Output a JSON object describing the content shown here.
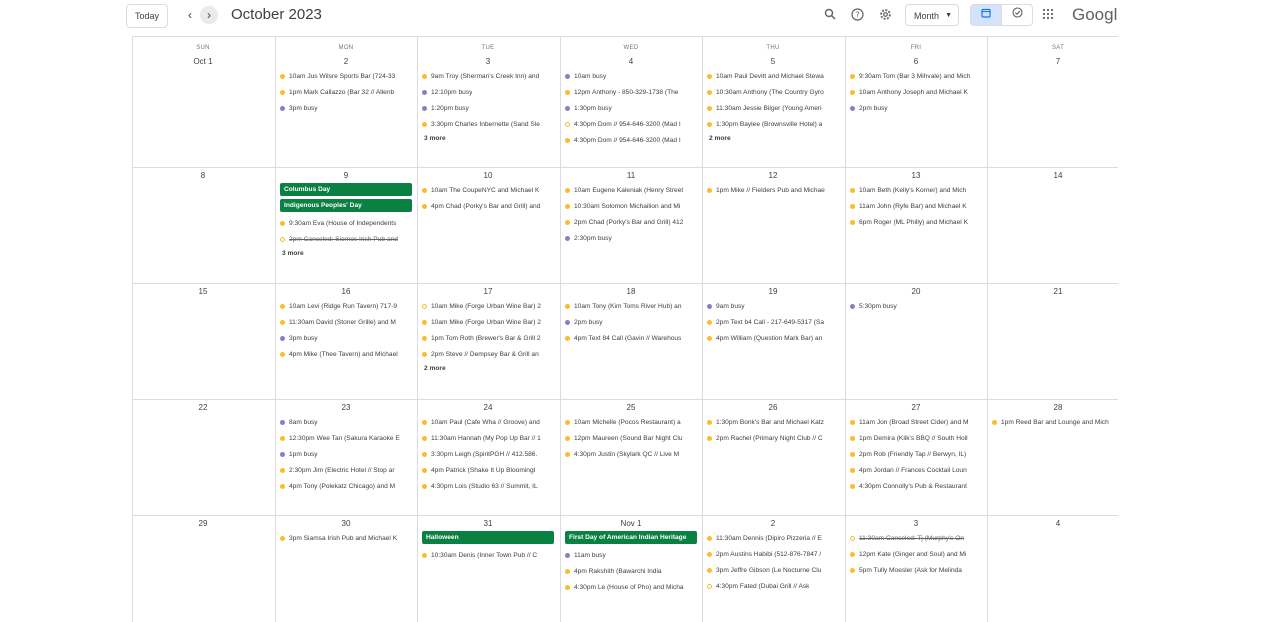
{
  "header": {
    "today_label": "Today",
    "prev_icon": "chevron-left-icon",
    "next_icon": "chevron-right-icon",
    "month_title": "October 2023",
    "search_icon": "search-icon",
    "help_icon": "help-icon",
    "settings_icon": "gear-icon",
    "view_select": "Month",
    "calendar_view_icon": "calendar-icon",
    "tasks_view_icon": "check-circle-icon",
    "apps_icon": "apps-grid-icon",
    "logo_text": "Google"
  },
  "colors": {
    "accent_yellow": "#f6bf26",
    "accent_purple": "#8e7cc3",
    "accent_blue": "#7986cb",
    "holiday_green": "#0b8043",
    "selected_toggle": "#d3e3fd"
  },
  "weekdays": [
    "SUN",
    "MON",
    "TUE",
    "WED",
    "THU",
    "FRI",
    "SAT"
  ],
  "weeks": [
    [
      {
        "day": "Oct 1",
        "events": []
      },
      {
        "day": "2",
        "events": [
          {
            "text": "10am Jus Wilsre Sports Bar (724-33",
            "color": "yellow"
          },
          {
            "text": "1pm Mark Callazzo (Bar 32 // Allenb",
            "color": "yellow"
          },
          {
            "text": "3pm busy",
            "color": "purple"
          }
        ]
      },
      {
        "day": "3",
        "events": [
          {
            "text": "9am Troy (Sherman's Creek Inn) and",
            "color": "yellow"
          },
          {
            "text": "12:10pm busy",
            "color": "purple"
          },
          {
            "text": "1:20pm busy",
            "color": "purple"
          },
          {
            "text": "3:30pm Charles Inbernette (Sand Sle",
            "color": "yellow"
          }
        ],
        "more": "3 more"
      },
      {
        "day": "4",
        "events": [
          {
            "text": "10am busy",
            "color": "purple"
          },
          {
            "text": "12pm Anthony - 850-329-1738 (The",
            "color": "yellow"
          },
          {
            "text": "1:30pm busy",
            "color": "purple"
          },
          {
            "text": "4:30pm Dom // 954-646-3200 (Mad I",
            "color": "hollow"
          },
          {
            "text": "4:30pm Dom // 954-646-3200 (Mad I",
            "color": "yellow"
          }
        ]
      },
      {
        "day": "5",
        "events": [
          {
            "text": "10am Paul Devitt and Michael Stewa",
            "color": "yellow"
          },
          {
            "text": "10:30am Anthony (The Country Gyro",
            "color": "yellow"
          },
          {
            "text": "11:30am Jessie Bilger (Young Ameri",
            "color": "yellow"
          },
          {
            "text": "1:30pm Baylee (Brownsville Hotel) a",
            "color": "yellow"
          }
        ],
        "more": "2 more"
      },
      {
        "day": "6",
        "events": [
          {
            "text": "9:30am Tom (Bar 3 Mihvale) and Mich",
            "color": "yellow"
          },
          {
            "text": "10am Anthony Joseph and Michael K",
            "color": "yellow"
          },
          {
            "text": "2pm busy",
            "color": "purple"
          }
        ]
      },
      {
        "day": "7",
        "events": []
      }
    ],
    [
      {
        "day": "8",
        "events": []
      },
      {
        "day": "9",
        "allday": [
          "Columbus Day",
          "Indigenous Peoples' Day"
        ],
        "events": [
          {
            "text": "9:30am Eva (House of Independents",
            "color": "yellow"
          },
          {
            "text": "2pm Canceled: Siomos Irish Pub and",
            "color": "hollow",
            "strike": true
          }
        ],
        "more": "3 more"
      },
      {
        "day": "10",
        "events": [
          {
            "text": "10am The CoupeNYC and Michael K",
            "color": "yellow"
          },
          {
            "text": "4pm Chad (Porky's Bar and Grill) and",
            "color": "yellow"
          }
        ]
      },
      {
        "day": "11",
        "events": [
          {
            "text": "10am Eugene Kaleniak (Henry Street",
            "color": "yellow"
          },
          {
            "text": "10:30am Solomon Michailion and Mi",
            "color": "yellow"
          },
          {
            "text": "2pm Chad (Porky's Bar and Grill) 412",
            "color": "yellow"
          },
          {
            "text": "2:30pm busy",
            "color": "purple"
          }
        ]
      },
      {
        "day": "12",
        "events": [
          {
            "text": "1pm Mike // Fielders Pub and Michae",
            "color": "yellow"
          }
        ]
      },
      {
        "day": "13",
        "events": [
          {
            "text": "10am Beth (Kelly's Korner) and Mich",
            "color": "yellow"
          },
          {
            "text": "11am John (Ryfe Bar) and Michael K",
            "color": "yellow"
          },
          {
            "text": "6pm Roger (ML Philly) and Michael K",
            "color": "yellow"
          }
        ]
      },
      {
        "day": "14",
        "events": []
      }
    ],
    [
      {
        "day": "15",
        "events": []
      },
      {
        "day": "16",
        "events": [
          {
            "text": "10am Levi (Ridge Run Tavern) 717-9",
            "color": "yellow"
          },
          {
            "text": "11:30am David (Stoner Grille) and M",
            "color": "yellow"
          },
          {
            "text": "3pm busy",
            "color": "purple"
          },
          {
            "text": "4pm Mike (Thee Tavern) and Michael",
            "color": "yellow"
          }
        ]
      },
      {
        "day": "17",
        "events": [
          {
            "text": "10am Mike (Forge Urban Wine Bar) 2",
            "color": "hollow"
          },
          {
            "text": "10am Mike (Forge Urban Wine Bar) 2",
            "color": "yellow"
          },
          {
            "text": "1pm Tom Roth (Brewer's Bar & Grill 2",
            "color": "yellow"
          },
          {
            "text": "2pm Steve // Dempsey Bar & Grill an",
            "color": "yellow"
          }
        ],
        "more": "2 more"
      },
      {
        "day": "18",
        "events": [
          {
            "text": "10am Tony (Kim Toms River Hub) an",
            "color": "yellow"
          },
          {
            "text": "2pm busy",
            "color": "purple"
          },
          {
            "text": "4pm Text 84 Call (Gavin // Warehous",
            "color": "yellow"
          }
        ]
      },
      {
        "day": "19",
        "events": [
          {
            "text": "9am busy",
            "color": "purple"
          },
          {
            "text": "2pm Text b4 Call - 217-649-5317 (Sa",
            "color": "yellow"
          },
          {
            "text": "4pm William (Question Mark Bar) an",
            "color": "yellow"
          }
        ]
      },
      {
        "day": "20",
        "events": [
          {
            "text": "5:30pm busy",
            "color": "purple"
          }
        ]
      },
      {
        "day": "21",
        "events": []
      }
    ],
    [
      {
        "day": "22",
        "events": []
      },
      {
        "day": "23",
        "events": [
          {
            "text": "8am busy",
            "color": "purple"
          },
          {
            "text": "12:30pm Wee Tan (Sakura Karaoke E",
            "color": "yellow"
          },
          {
            "text": "1pm busy",
            "color": "purple"
          },
          {
            "text": "2:30pm Jim (Electric Hotel // Stop ar",
            "color": "yellow"
          },
          {
            "text": "4pm Tony (Polekatz Chicago) and M",
            "color": "yellow"
          }
        ]
      },
      {
        "day": "24",
        "events": [
          {
            "text": "10am Paul (Cafe Wha // Groove) and",
            "color": "yellow"
          },
          {
            "text": "11:30am Hannah (My Pop Up Bar // 1",
            "color": "yellow"
          },
          {
            "text": "3:30pm Leigh (SpiritPGH // 412.586.",
            "color": "yellow"
          },
          {
            "text": "4pm Patrick (Shake It Up Bloomingt",
            "color": "yellow"
          },
          {
            "text": "4:30pm Lois (Studio 63 // Summit, IL",
            "color": "yellow"
          }
        ]
      },
      {
        "day": "25",
        "events": [
          {
            "text": "10am Michelle (Pocos Restaurant) a",
            "color": "yellow"
          },
          {
            "text": "12pm Maureen (Sound Bar Night Clu",
            "color": "yellow"
          },
          {
            "text": "4:30pm Justin (Skylark QC // Live M",
            "color": "yellow"
          }
        ]
      },
      {
        "day": "26",
        "events": [
          {
            "text": "1:30pm Bonk's Bar and Michael Katz",
            "color": "yellow"
          },
          {
            "text": "2pm Rachel (Primary Night Club // C",
            "color": "yellow"
          }
        ]
      },
      {
        "day": "27",
        "events": [
          {
            "text": "11am Jon (Broad Street Cider) and M",
            "color": "yellow"
          },
          {
            "text": "1pm Demira (Kilk's BBQ // South Holl",
            "color": "yellow"
          },
          {
            "text": "2pm Rob (Friendly Tap // Berwyn, IL)",
            "color": "yellow"
          },
          {
            "text": "4pm Jordan // Frances Cocktail Loun",
            "color": "yellow"
          },
          {
            "text": "4:30pm Connolly's Pub & Restaurant",
            "color": "yellow"
          }
        ]
      },
      {
        "day": "28",
        "events": [
          {
            "text": "1pm Reed Bar and Lounge and Mich",
            "color": "yellow"
          }
        ]
      }
    ],
    [
      {
        "day": "29",
        "events": []
      },
      {
        "day": "30",
        "events": [
          {
            "text": "3pm Siamsa Irish Pub and Michael K",
            "color": "yellow"
          }
        ]
      },
      {
        "day": "31",
        "allday": [
          "Halloween"
        ],
        "events": [
          {
            "text": "10:30am Denis (Inner Town Pub // C",
            "color": "yellow"
          }
        ]
      },
      {
        "day": "Nov 1",
        "allday": [
          "First Day of American Indian Heritage"
        ],
        "events": [
          {
            "text": "11am busy",
            "color": "purple"
          },
          {
            "text": "4pm Rakshith (Bawarchi India",
            "color": "yellow"
          },
          {
            "text": "4:30pm Le (House of Pho) and Micha",
            "color": "yellow"
          }
        ]
      },
      {
        "day": "2",
        "events": [
          {
            "text": "11:30am Dennis (Dipiro Pizzeria // E",
            "color": "yellow"
          },
          {
            "text": "2pm Austins Habibi (512-876-7847 /",
            "color": "yellow"
          },
          {
            "text": "3pm Jeffre Gibson (Le Nocturne Clu",
            "color": "yellow"
          },
          {
            "text": "4:30pm Fated (Dubai Grill // Ask",
            "color": "hollow"
          }
        ]
      },
      {
        "day": "3",
        "events": [
          {
            "text": "11:30am Canceled: Tj (Murphy's On",
            "color": "hollow",
            "strike": true
          },
          {
            "text": "12pm Kate (Ginger and Soul) and Mi",
            "color": "yellow"
          },
          {
            "text": "5pm Tully Moesler (Ask for Melinda",
            "color": "yellow"
          }
        ]
      },
      {
        "day": "4",
        "events": []
      }
    ]
  ]
}
